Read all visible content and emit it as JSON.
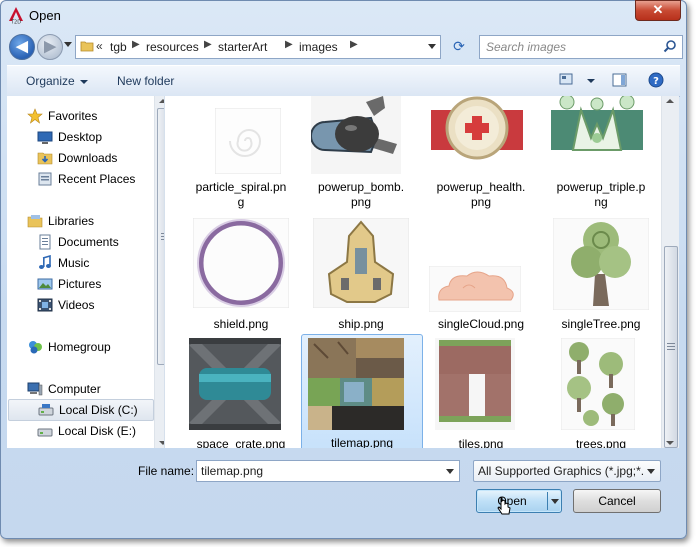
{
  "window": {
    "title": "Open",
    "close_label": "✕"
  },
  "address": {
    "lead": "«",
    "crumbs": [
      "tgb",
      "resources",
      "starterArt",
      "images"
    ],
    "search_placeholder": "Search images"
  },
  "toolbar": {
    "organize_label": "Organize",
    "new_folder_label": "New folder"
  },
  "nav": {
    "favorites": "Favorites",
    "desktop": "Desktop",
    "downloads": "Downloads",
    "recent_places": "Recent Places",
    "libraries": "Libraries",
    "documents": "Documents",
    "music": "Music",
    "pictures": "Pictures",
    "videos": "Videos",
    "homegroup": "Homegroup",
    "computer": "Computer",
    "local_disk_c": "Local Disk (C:)",
    "local_disk_e": "Local Disk (E:)"
  },
  "files": [
    {
      "line1": "particle_spiral.pn",
      "line2": "g"
    },
    {
      "line1": "powerup_bomb.",
      "line2": "png"
    },
    {
      "line1": "powerup_health.",
      "line2": "png"
    },
    {
      "line1": "powerup_triple.p",
      "line2": "ng"
    },
    {
      "line1": "shield.png",
      "line2": ""
    },
    {
      "line1": "ship.png",
      "line2": ""
    },
    {
      "line1": "singleCloud.png",
      "line2": ""
    },
    {
      "line1": "singleTree.png",
      "line2": ""
    },
    {
      "line1": "space_crate.png",
      "line2": ""
    },
    {
      "line1": "tilemap.png",
      "line2": ""
    },
    {
      "line1": "tiles.png",
      "line2": ""
    },
    {
      "line1": "trees.png",
      "line2": ""
    }
  ],
  "bottom": {
    "file_name_label": "File name:",
    "file_name_value": "tilemap.png",
    "filter_value": "All Supported Graphics (*.jpg;*.",
    "open_label": "Open",
    "cancel_label": "Cancel"
  }
}
